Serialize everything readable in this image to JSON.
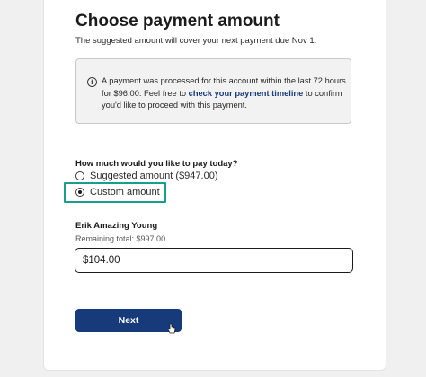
{
  "page": {
    "title": "Choose payment amount",
    "subtitle": "The suggested amount will cover your next payment due Nov 1."
  },
  "notice": {
    "icon": "info-icon",
    "text_before": "A payment was processed for this account within the last 72 hours for $96.00. Feel free to ",
    "link_text": "check your payment timeline",
    "text_after": " to confirm you'd like to proceed with this payment."
  },
  "payment_options": {
    "question": "How much would you like to pay today?",
    "suggested_label": "Suggested amount ($947.00)",
    "custom_label": "Custom amount",
    "selected": "custom"
  },
  "payer": {
    "name": "Erik Amazing Young",
    "remaining_total": "Remaining total: $997.00"
  },
  "amount_input": {
    "value": "$104.00"
  },
  "actions": {
    "next_label": "Next"
  },
  "colors": {
    "primary": "#163a7a",
    "highlight": "#1a9e8c"
  }
}
